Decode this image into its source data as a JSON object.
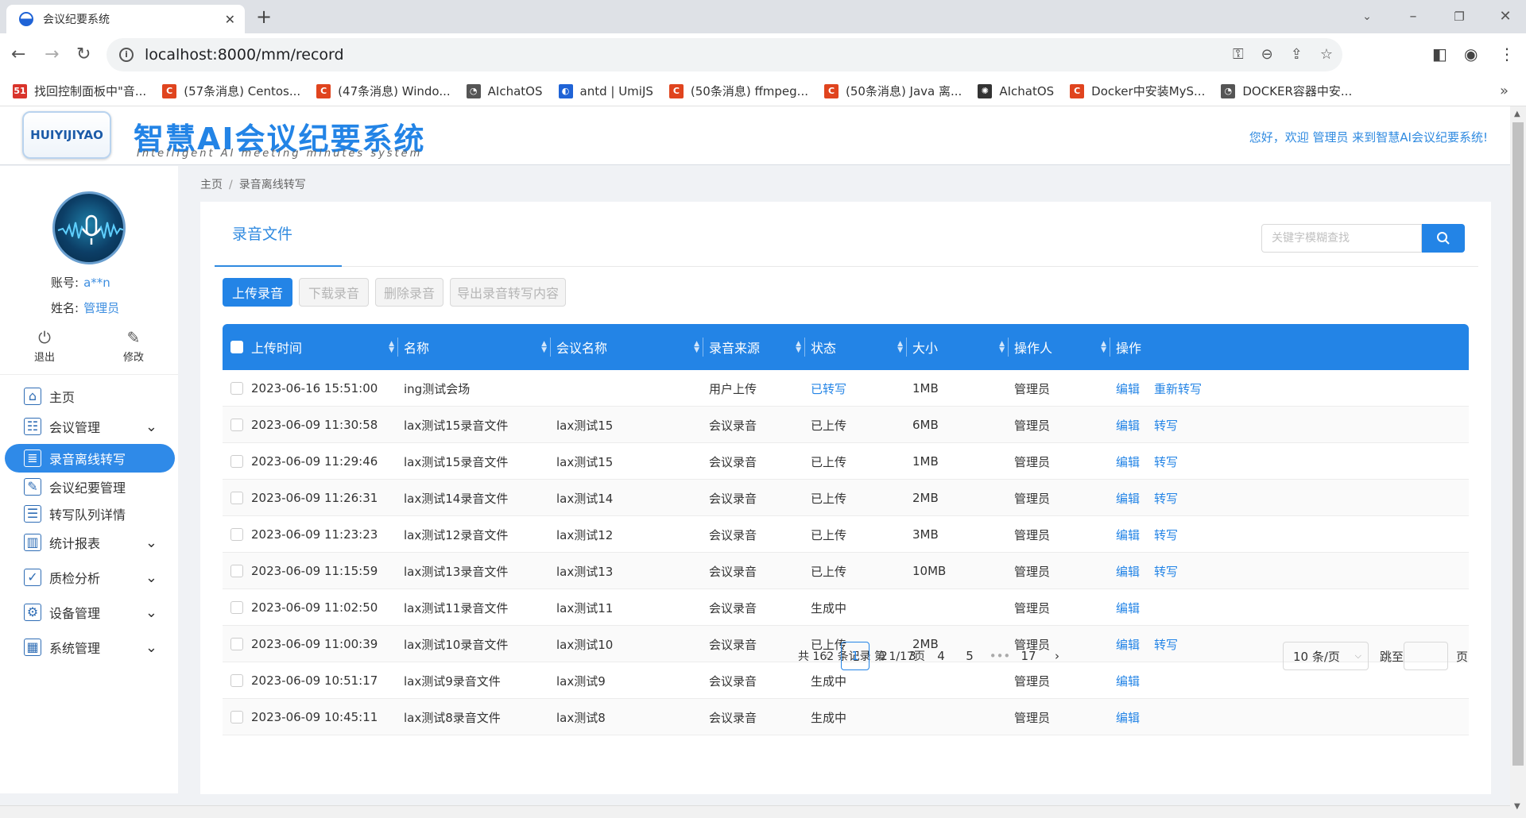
{
  "browser": {
    "tab_title": "会议纪要系统",
    "url": "localhost:8000/mm/record",
    "bookmarks": [
      {
        "label": "找回控制面板中\"音...",
        "icon": "51",
        "color": "#d9342b"
      },
      {
        "label": "(57条消息) Centos...",
        "icon": "C",
        "color": "#e0441e"
      },
      {
        "label": "(47条消息) Windo...",
        "icon": "C",
        "color": "#e0441e"
      },
      {
        "label": "AIchatOS",
        "icon": "◔",
        "color": "#555555"
      },
      {
        "label": "antd | UmiJS",
        "icon": "◐",
        "color": "#1f63d6"
      },
      {
        "label": "(50条消息) ffmpeg...",
        "icon": "C",
        "color": "#e0441e"
      },
      {
        "label": "(50条消息) Java 离...",
        "icon": "C",
        "color": "#e0441e"
      },
      {
        "label": "AIchatOS",
        "icon": "✺",
        "color": "#333333"
      },
      {
        "label": "Docker中安装MyS...",
        "icon": "C",
        "color": "#e0441e"
      },
      {
        "label": "DOCKER容器中安...",
        "icon": "◔",
        "color": "#555555"
      }
    ]
  },
  "header": {
    "logo_text": "HUIYIJIYAO",
    "title": "智慧AI会议纪要系统",
    "subtitle": "Intelligent AI meeting minutes system",
    "welcome": "您好，欢迎 管理员 来到智慧AI会议纪要系统!"
  },
  "sidebar": {
    "account_label": "账号:",
    "account_value": "a**n",
    "name_label": "姓名:",
    "name_value": "管理员",
    "logout": "退出",
    "edit": "修改",
    "items": [
      {
        "label": "主页",
        "icon": "home-icon",
        "glyph": "⌂",
        "arrow": false,
        "active": false
      },
      {
        "label": "会议管理",
        "icon": "meeting-icon",
        "glyph": "☷",
        "arrow": true,
        "active": false
      },
      {
        "label": "录音离线转写",
        "icon": "record-icon",
        "glyph": "≣",
        "arrow": false,
        "active": true
      },
      {
        "label": "会议纪要管理",
        "icon": "minutes-icon",
        "glyph": "✎",
        "arrow": false,
        "active": false
      },
      {
        "label": "转写队列详情",
        "icon": "queue-icon",
        "glyph": "☰",
        "arrow": false,
        "active": false
      },
      {
        "label": "统计报表",
        "icon": "chart-icon",
        "glyph": "▥",
        "arrow": true,
        "active": false
      },
      {
        "label": "质检分析",
        "icon": "qc-icon",
        "glyph": "✓",
        "arrow": true,
        "active": false
      },
      {
        "label": "设备管理",
        "icon": "device-icon",
        "glyph": "⚙",
        "arrow": true,
        "active": false
      },
      {
        "label": "系统管理",
        "icon": "system-icon",
        "glyph": "▦",
        "arrow": true,
        "active": false
      }
    ]
  },
  "breadcrumb": {
    "home": "主页",
    "sep": "/",
    "current": "录音离线转写"
  },
  "panel": {
    "tab": "录音文件",
    "search_placeholder": "关键字模糊查找",
    "buttons": {
      "upload": "上传录音",
      "download": "下载录音",
      "delete": "删除录音",
      "export": "导出录音转写内容"
    }
  },
  "table": {
    "columns": [
      "上传时间",
      "名称",
      "会议名称",
      "录音来源",
      "状态",
      "大小",
      "操作人",
      "操作"
    ],
    "rows": [
      {
        "time": "2023-06-16 15:51:00",
        "name": "ing测试会场",
        "meeting": "",
        "source": "用户上传",
        "status": "已转写",
        "status_link": true,
        "size": "1MB",
        "operator": "管理员",
        "ops": [
          "编辑",
          "重新转写"
        ]
      },
      {
        "time": "2023-06-09 11:30:58",
        "name": "lax测试15录音文件",
        "meeting": "lax测试15",
        "source": "会议录音",
        "status": "已上传",
        "status_link": false,
        "size": "6MB",
        "operator": "管理员",
        "ops": [
          "编辑",
          "转写"
        ]
      },
      {
        "time": "2023-06-09 11:29:46",
        "name": "lax测试15录音文件",
        "meeting": "lax测试15",
        "source": "会议录音",
        "status": "已上传",
        "status_link": false,
        "size": "1MB",
        "operator": "管理员",
        "ops": [
          "编辑",
          "转写"
        ]
      },
      {
        "time": "2023-06-09 11:26:31",
        "name": "lax测试14录音文件",
        "meeting": "lax测试14",
        "source": "会议录音",
        "status": "已上传",
        "status_link": false,
        "size": "2MB",
        "operator": "管理员",
        "ops": [
          "编辑",
          "转写"
        ]
      },
      {
        "time": "2023-06-09 11:23:23",
        "name": "lax测试12录音文件",
        "meeting": "lax测试12",
        "source": "会议录音",
        "status": "已上传",
        "status_link": false,
        "size": "3MB",
        "operator": "管理员",
        "ops": [
          "编辑",
          "转写"
        ]
      },
      {
        "time": "2023-06-09 11:15:59",
        "name": "lax测试13录音文件",
        "meeting": "lax测试13",
        "source": "会议录音",
        "status": "已上传",
        "status_link": false,
        "size": "10MB",
        "operator": "管理员",
        "ops": [
          "编辑",
          "转写"
        ]
      },
      {
        "time": "2023-06-09 11:02:50",
        "name": "lax测试11录音文件",
        "meeting": "lax测试11",
        "source": "会议录音",
        "status": "生成中",
        "status_link": false,
        "size": "",
        "operator": "管理员",
        "ops": [
          "编辑"
        ]
      },
      {
        "time": "2023-06-09 11:00:39",
        "name": "lax测试10录音文件",
        "meeting": "lax测试10",
        "source": "会议录音",
        "status": "已上传",
        "status_link": false,
        "size": "2MB",
        "operator": "管理员",
        "ops": [
          "编辑",
          "转写"
        ]
      },
      {
        "time": "2023-06-09 10:51:17",
        "name": "lax测试9录音文件",
        "meeting": "lax测试9",
        "source": "会议录音",
        "status": "生成中",
        "status_link": false,
        "size": "",
        "operator": "管理员",
        "ops": [
          "编辑"
        ]
      },
      {
        "time": "2023-06-09 10:45:11",
        "name": "lax测试8录音文件",
        "meeting": "lax测试8",
        "source": "会议录音",
        "status": "生成中",
        "status_link": false,
        "size": "",
        "operator": "管理员",
        "ops": [
          "编辑"
        ]
      }
    ]
  },
  "pagination": {
    "total_text": "共  162  条记录  第  1/17页",
    "pages": [
      "1",
      "2",
      "3",
      "4",
      "5",
      "•••",
      "17"
    ],
    "current": "1",
    "page_size": "10 条/页",
    "goto_label": "跳至",
    "page_label": "页"
  },
  "colors": {
    "accent": "#2384e6",
    "active_menu": "#2f8ae8"
  }
}
